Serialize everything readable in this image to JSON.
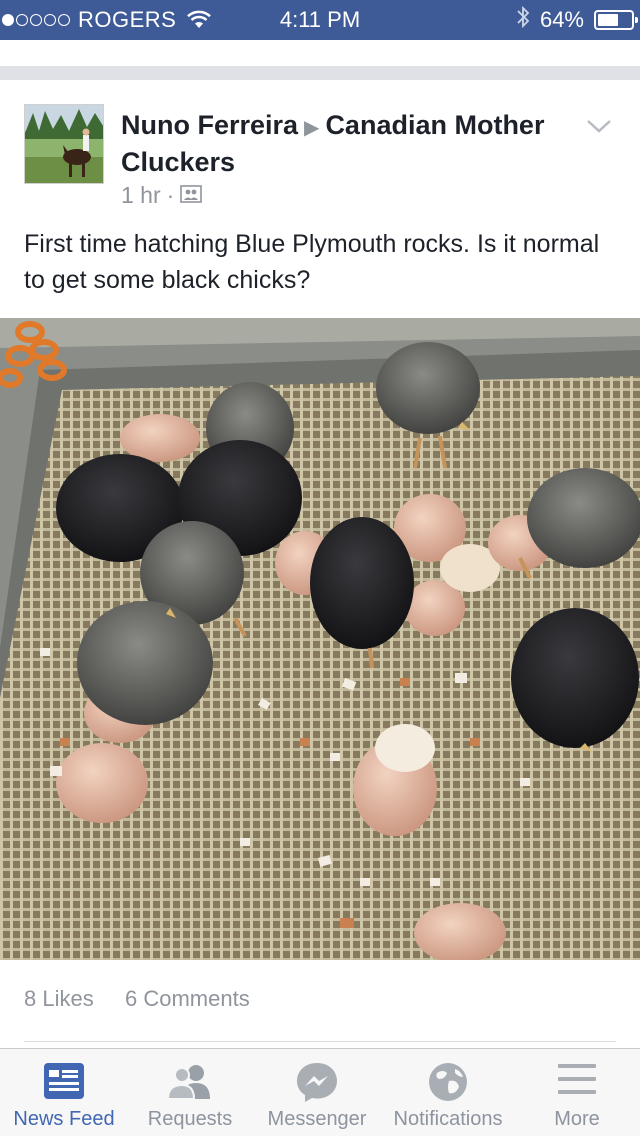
{
  "status_bar": {
    "carrier": "ROGERS",
    "time": "4:11 PM",
    "battery": "64%",
    "battery_level": 0.64,
    "signal_dots_filled": 1,
    "signal_dots_total": 5
  },
  "post": {
    "author": "Nuno Ferreira",
    "group": "Canadian Mother Cluckers",
    "time": "1 hr",
    "text": "First time hatching Blue Plymouth rocks. Is it normal to get some black chicks?",
    "likes": "8 Likes",
    "comments": "6 Comments"
  },
  "tabs": [
    {
      "label": "News Feed",
      "icon": "news-feed-icon",
      "active": true
    },
    {
      "label": "Requests",
      "icon": "friend-requests-icon",
      "active": false
    },
    {
      "label": "Messenger",
      "icon": "messenger-icon",
      "active": false
    },
    {
      "label": "Notifications",
      "icon": "globe-icon",
      "active": false
    },
    {
      "label": "More",
      "icon": "menu-icon",
      "active": false
    }
  ],
  "colors": {
    "status_bar": "#3f5b97",
    "active_tab": "#4267b2",
    "inactive_tab": "#8d949e",
    "muted_text": "#90949c",
    "body_text": "#1d2129"
  }
}
